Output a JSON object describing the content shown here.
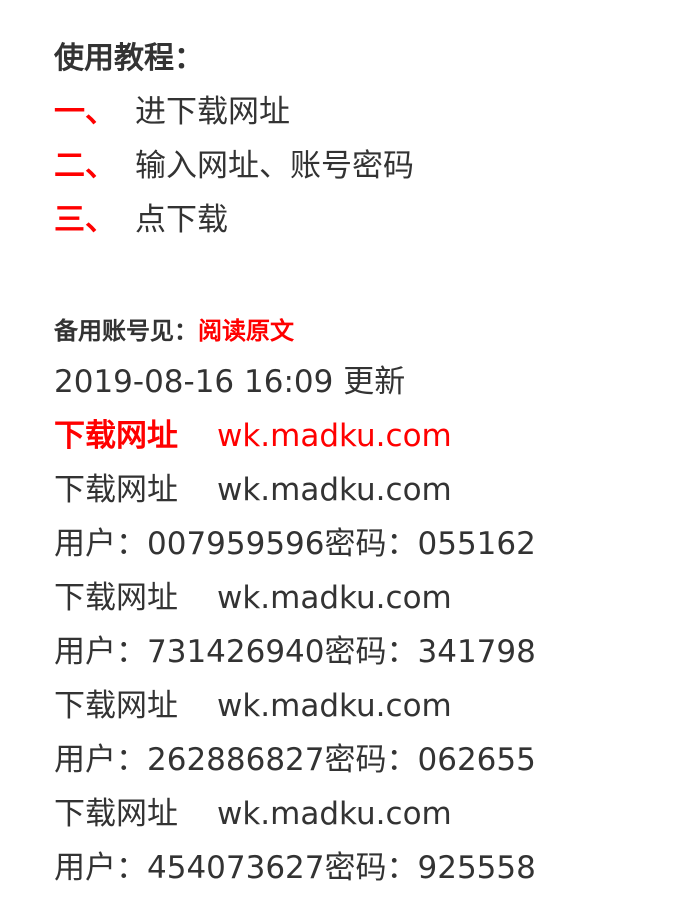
{
  "heading": "使用教程：",
  "steps": [
    {
      "num": "一、",
      "text": "进下载网址"
    },
    {
      "num": "二、",
      "text": "输入网址、账号密码"
    },
    {
      "num": "三、",
      "text": "点下载"
    }
  ],
  "backup": {
    "label": "备用账号见：",
    "link": "阅读原文"
  },
  "updated": "2019-08-16 16:09 更新",
  "featured": {
    "label": "下载网址",
    "url": "wk.madku.com"
  },
  "accounts": [
    {
      "label": "下载网址",
      "url": "wk.madku.com",
      "credentials": "用户：007959596密码：055162"
    },
    {
      "label": "下载网址",
      "url": "wk.madku.com",
      "credentials": "用户：731426940密码：341798"
    },
    {
      "label": "下载网址",
      "url": "wk.madku.com",
      "credentials": "用户：262886827密码：062655"
    },
    {
      "label": "下载网址",
      "url": "wk.madku.com",
      "credentials": "用户：454073627密码：925558"
    }
  ],
  "colors": {
    "accent": "#ff0000",
    "text": "#333333"
  }
}
